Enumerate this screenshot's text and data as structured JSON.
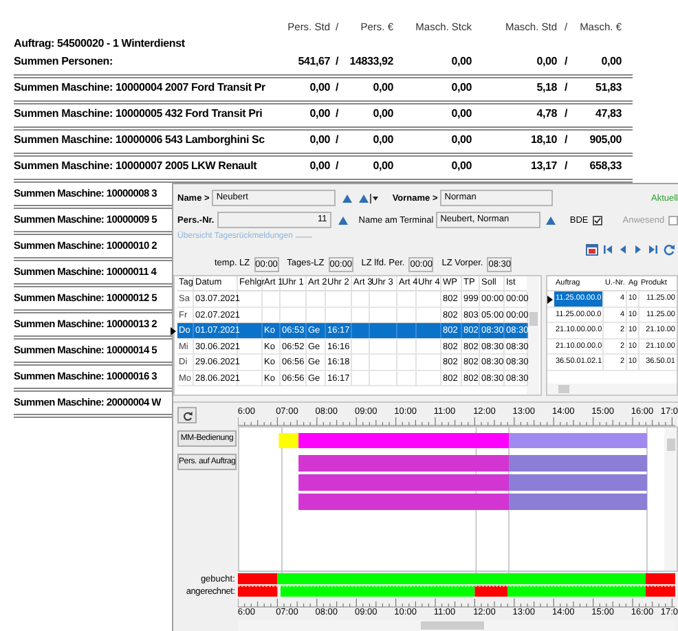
{
  "report": {
    "columns": [
      "Pers. Std",
      "/",
      "Pers. €",
      "Masch. Stck",
      "Masch. Std",
      "/",
      "Masch. €"
    ],
    "order": "Auftrag: 54500020 - 1 Winterdienst",
    "rows": [
      {
        "label": "Summen Personen:",
        "values": [
          "541,67",
          "/",
          "14833,92",
          "0,00",
          "0,00",
          "/",
          "0,00"
        ]
      },
      {
        "label": "Summen Maschine: 10000004 2007 Ford Transit Pr",
        "values": [
          "0,00",
          "/",
          "0,00",
          "0,00",
          "5,18",
          "/",
          "51,83"
        ]
      },
      {
        "label": "Summen Maschine: 10000005 432 Ford Transit Pri",
        "values": [
          "0,00",
          "/",
          "0,00",
          "0,00",
          "4,78",
          "/",
          "47,83"
        ]
      },
      {
        "label": "Summen Maschine: 10000006 543 Lamborghini Sc",
        "values": [
          "0,00",
          "/",
          "0,00",
          "0,00",
          "18,10",
          "/",
          "905,00"
        ]
      },
      {
        "label": "Summen Maschine: 10000007 2005 LKW Renault",
        "values": [
          "0,00",
          "/",
          "0,00",
          "0,00",
          "13,17",
          "/",
          "658,33"
        ]
      }
    ],
    "covered_rows": [
      "Summen Maschine: 10000008 3",
      "Summen Maschine: 10000009 5",
      "Summen Maschine: 10000010 2",
      "Summen Maschine: 10000011 4",
      "Summen Maschine: 10000012 5",
      "Summen Maschine: 10000013 2",
      "Summen Maschine: 10000014 5",
      "Summen Maschine: 10000016 3",
      "Summen Maschine: 20000004 W"
    ]
  },
  "window": {
    "header": {
      "name": {
        "label": "Name >",
        "value": "Neubert"
      },
      "first_name": {
        "label": "Vorname >",
        "value": "Norman"
      },
      "status": "Aktuell",
      "pers_nr": {
        "label": "Pers.-Nr.",
        "value": "11"
      },
      "terminal_name": {
        "label": "Name am Terminal",
        "value": "Neubert, Norman"
      },
      "bde": {
        "label": "BDE",
        "checked": true
      },
      "present": {
        "label": "Anwesend",
        "checked": false,
        "disabled": true
      }
    },
    "group_title": "Übersicht Tagesrückmeldungen",
    "summary": [
      {
        "label": "temp. LZ",
        "value": "00:00"
      },
      {
        "label": "Tages-LZ",
        "value": "00:00"
      },
      {
        "label": "LZ lfd. Per.",
        "value": "00:00"
      },
      {
        "label": "LZ Vorper.",
        "value": "08:30"
      }
    ],
    "days_table": {
      "columns": [
        "Tag",
        "Datum",
        "Fehlgr",
        "Art 1",
        "Uhr 1",
        "Art 2",
        "Uhr 2",
        "Art 3",
        "Uhr 3",
        "Art 4",
        "Uhr 4",
        "WP",
        "TP",
        "Soll",
        "Ist"
      ],
      "rows": [
        {
          "selected": false,
          "cells": {
            "tag": "Sa",
            "date": "03.07.2021",
            "wp": "802",
            "tp": "999",
            "target": "00:00",
            "actual": "00:00"
          }
        },
        {
          "selected": false,
          "cells": {
            "tag": "Fr",
            "date": "02.07.2021",
            "wp": "802",
            "tp": "803",
            "target": "05:00",
            "actual": "00:00"
          }
        },
        {
          "selected": true,
          "cells": {
            "tag": "Do",
            "date": "01.07.2021",
            "type_1": "Ko",
            "time_1": "06:53",
            "type_2": "Ge",
            "time_2": "16:17",
            "wp": "802",
            "tp": "802",
            "target": "08:30",
            "actual": "08:30"
          }
        },
        {
          "selected": false,
          "cells": {
            "tag": "Mi",
            "date": "30.06.2021",
            "type_1": "Ko",
            "time_1": "06:52",
            "type_2": "Ge",
            "time_2": "16:16",
            "wp": "802",
            "tp": "802",
            "target": "08:30",
            "actual": "08:30"
          }
        },
        {
          "selected": false,
          "cells": {
            "tag": "Di",
            "date": "29.06.2021",
            "type_1": "Ko",
            "time_1": "06:56",
            "type_2": "Ge",
            "time_2": "16:18",
            "wp": "802",
            "tp": "802",
            "target": "08:30",
            "actual": "08:30"
          }
        },
        {
          "selected": false,
          "cells": {
            "tag": "Mo",
            "date": "28.06.2021",
            "type_1": "Ko",
            "time_1": "06:56",
            "type_2": "Ge",
            "time_2": "16:17",
            "wp": "802",
            "tp": "802",
            "target": "08:30",
            "actual": "08:30"
          }
        }
      ]
    },
    "orders_table": {
      "columns": [
        "Auftrag",
        "U.-Nr.",
        "Ag",
        "Produkt"
      ],
      "rows": [
        {
          "selected": true,
          "cells": [
            "11.25.00.00.0",
            "4",
            "10",
            "11.25.00"
          ]
        },
        {
          "selected": false,
          "cells": [
            "11.25.00.00.0",
            "4",
            "10",
            "11.25.00"
          ]
        },
        {
          "selected": false,
          "cells": [
            "21.10.00.00.0",
            "2",
            "10",
            "21.10.00"
          ]
        },
        {
          "selected": false,
          "cells": [
            "21.10.00.00.0",
            "2",
            "10",
            "21.10.00"
          ]
        },
        {
          "selected": false,
          "cells": [
            "36.50.01.02.1",
            "2",
            "10",
            "36.50.01"
          ]
        }
      ]
    },
    "buttons": [
      "MM-Bedienung",
      "Pers. auf Auftrag"
    ],
    "timeline": {
      "top_ticks": [
        "6:00",
        "07:00",
        "08:00",
        "09:00",
        "10:00",
        "11:00",
        "12:00",
        "13:00",
        "14:00",
        "15:00",
        "16:00",
        "17:0"
      ],
      "bottom_ticks": [
        "6:00",
        "07:00",
        "08:00",
        "09:00",
        "10:00",
        "11:00",
        "12:00",
        "13:00",
        "14:00",
        "15:00",
        "16:00",
        "17:0"
      ],
      "booked_label": "gebucht:",
      "credited_label": "angerechnet:"
    }
  }
}
